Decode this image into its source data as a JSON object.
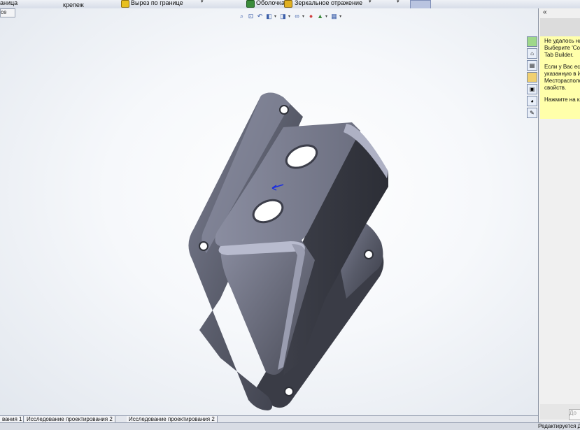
{
  "toolbar": {
    "label_left": "аница",
    "label_krep": "крепеж",
    "label_cut_boundary": "Вырез по границе",
    "label_shell": "Оболочка",
    "label_mirror": "Зеркальное отражение"
  },
  "tab_stub": "се",
  "view_toolbar": {
    "icons": [
      "zoom-to-fit-icon",
      "zoom-area-icon",
      "previous-view-icon",
      "section-view-icon",
      "view-orientation-icon",
      "display-style-icon",
      "hide-show-icon",
      "appearance-icon",
      "scene-icon",
      "view-settings-icon"
    ]
  },
  "task_pane": {
    "collapse": "«",
    "paragraph1": [
      "Не удалось най",
      "Выберите 'Соз",
      "Tab Builder."
    ],
    "paragraph2": [
      "Если у Вас есть",
      "указанную в И",
      "Месторасполо",
      "свойств."
    ],
    "paragraph3": [
      "Нажмите на кл"
    ],
    "button": "До"
  },
  "bottom_tabs": [
    "вания 1",
    "Исследование проектирования 2",
    "Исследование проектирования 2"
  ],
  "status": "Редактируется Д",
  "colors": {
    "part_fill": "#5f6270",
    "part_light": "#9c9fb2",
    "accent_yellow": "#ffffaa"
  }
}
